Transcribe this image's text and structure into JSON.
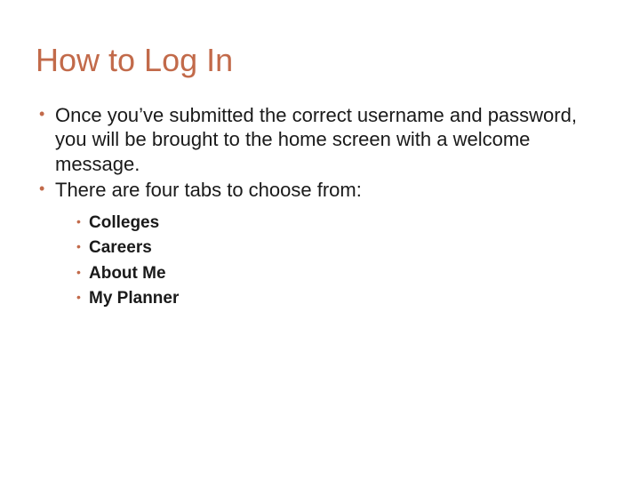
{
  "title": "How to Log In",
  "bullets": [
    "Once you’ve submitted the correct username and password, you will be brought to the home screen with a welcome message.",
    "There are four tabs to choose from:"
  ],
  "subBullets": [
    "Colleges",
    "Careers",
    "About Me",
    "My Planner"
  ]
}
